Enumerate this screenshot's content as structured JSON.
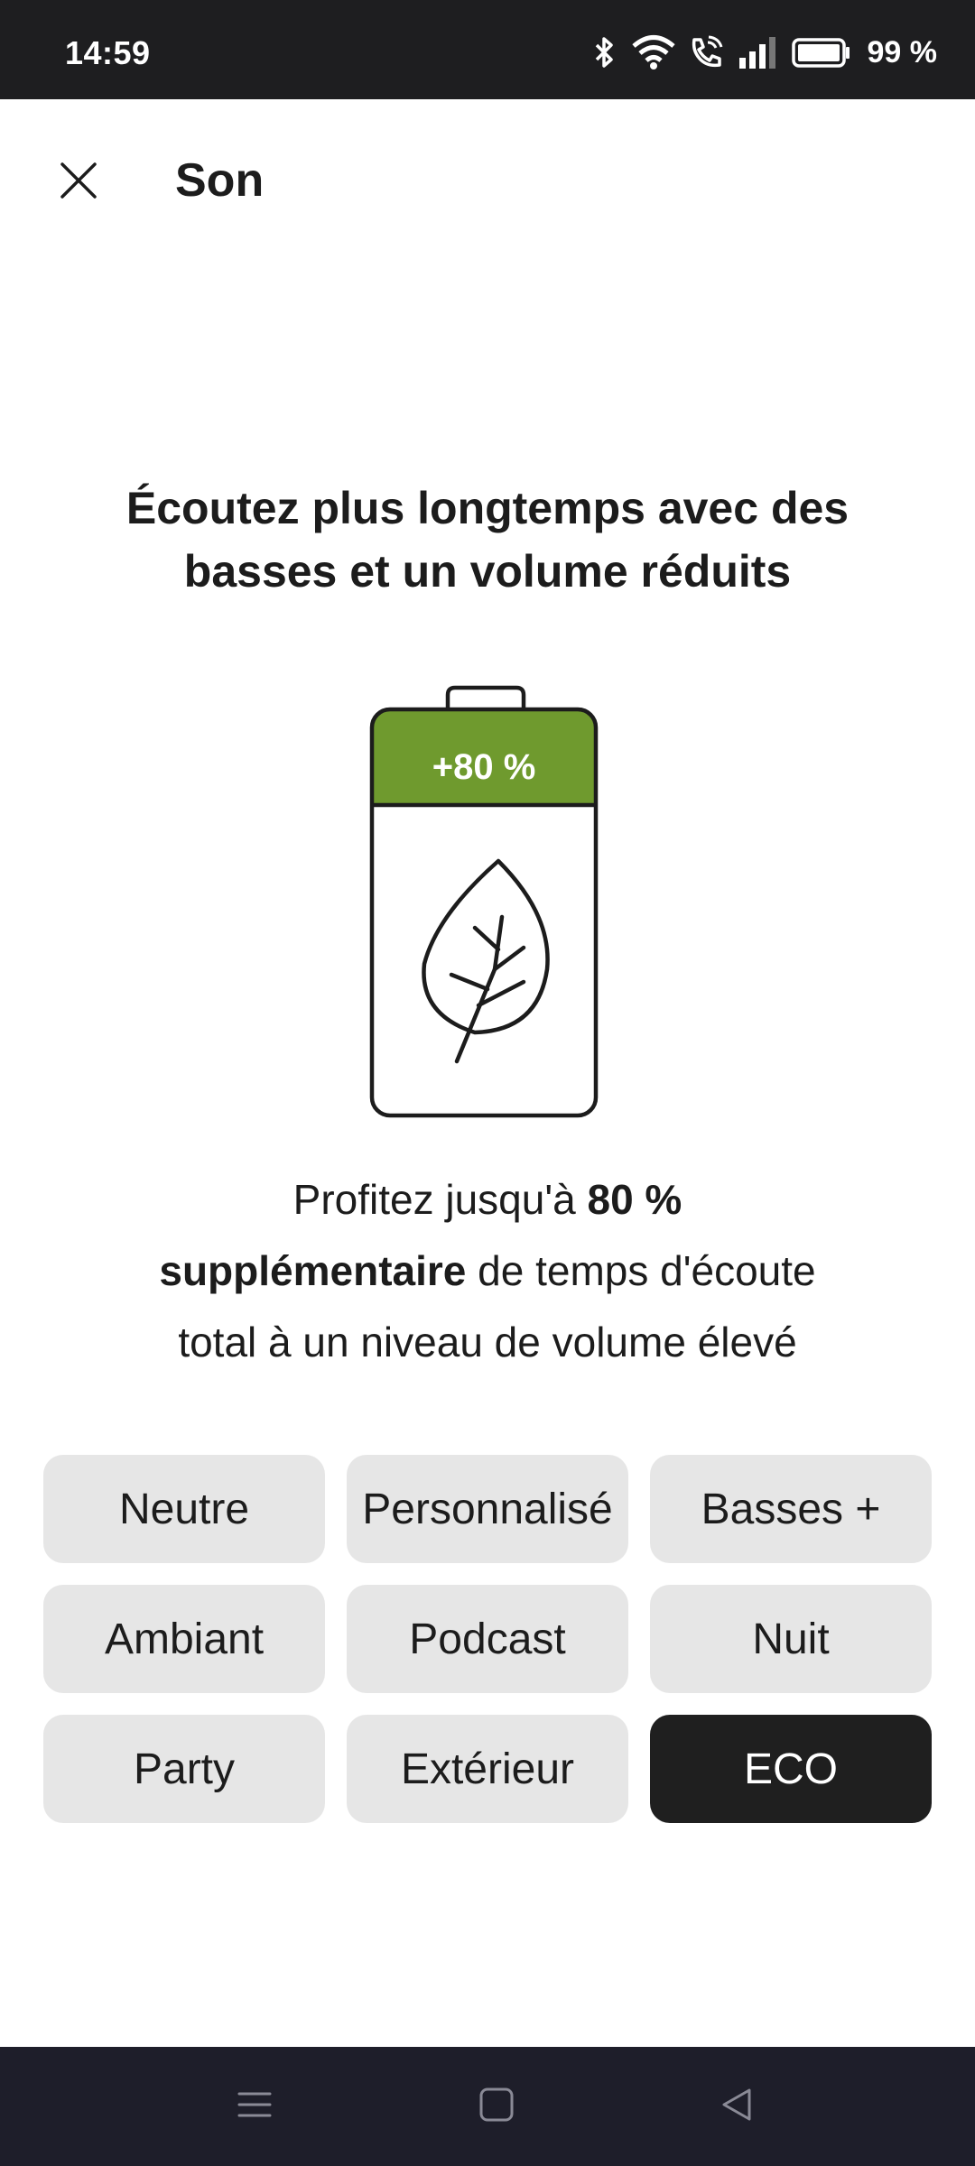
{
  "status_bar": {
    "time": "14:59",
    "battery_text": "99 %",
    "icons": [
      "bluetooth-icon",
      "wifi-icon",
      "wifi-call-icon",
      "signal-icon",
      "battery-icon"
    ]
  },
  "header": {
    "title": "Son",
    "close_icon": "close-icon"
  },
  "headline": {
    "line1": "Écoutez plus longtemps avec des",
    "line2": "basses et un volume réduits"
  },
  "battery_illustration": {
    "badge": "+80 %",
    "accent_color": "#6f9a2e",
    "icon": "leaf-icon"
  },
  "description": {
    "part1": "Profitez jusqu'à ",
    "bold1": "80 %",
    "bold2": "supplémentaire",
    "part2": " de temps d'écoute",
    "part3": "total à un niveau de volume élevé"
  },
  "presets": [
    {
      "label": "Neutre",
      "selected": false
    },
    {
      "label": "Personnalisé",
      "selected": false
    },
    {
      "label": "Basses +",
      "selected": false
    },
    {
      "label": "Ambiant",
      "selected": false
    },
    {
      "label": "Podcast",
      "selected": false
    },
    {
      "label": "Nuit",
      "selected": false
    },
    {
      "label": "Party",
      "selected": false
    },
    {
      "label": "Extérieur",
      "selected": false
    },
    {
      "label": "ECO",
      "selected": true
    }
  ],
  "nav_bar": {
    "icons": [
      "menu-icon",
      "home-icon",
      "back-icon"
    ]
  }
}
